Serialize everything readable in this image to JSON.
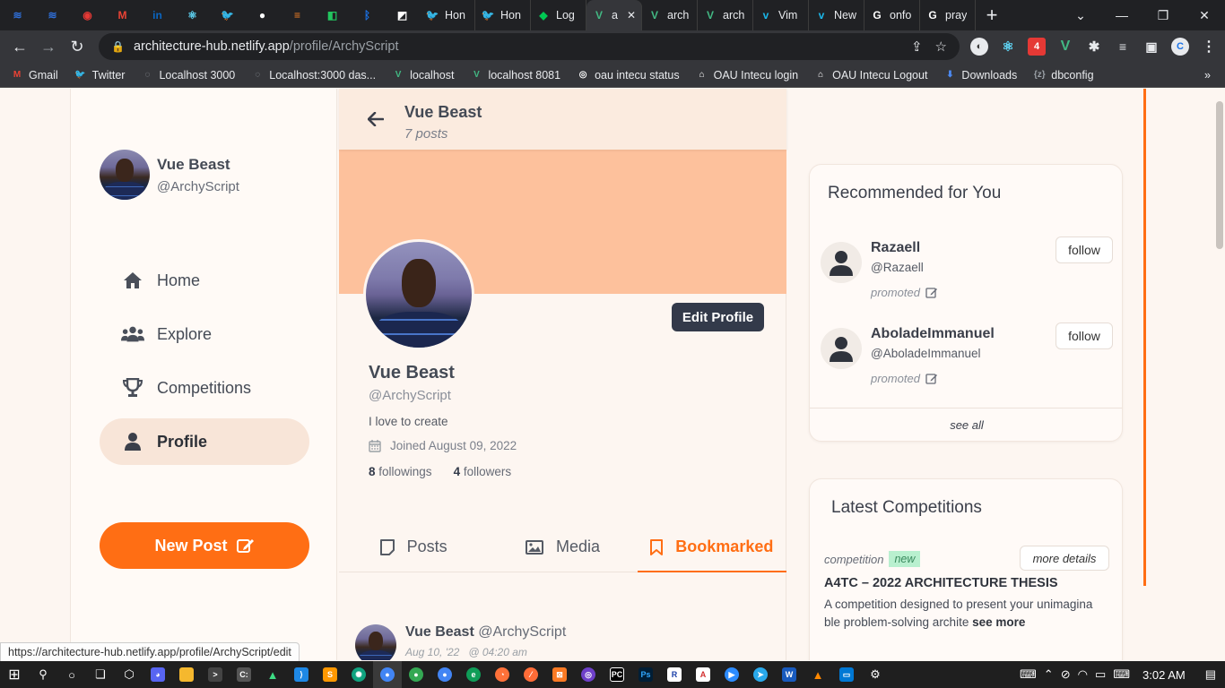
{
  "browser": {
    "tabs": [
      {
        "title": "",
        "color": "#2f6fd8",
        "glyph": "≋"
      },
      {
        "title": "",
        "color": "#2f6fd8",
        "glyph": "≋"
      },
      {
        "title": "",
        "color": "#e53935",
        "glyph": "◉"
      },
      {
        "title": "",
        "color": "#ea4335",
        "glyph": "M"
      },
      {
        "title": "",
        "color": "#0a66c2",
        "glyph": "in"
      },
      {
        "title": "",
        "color": "#61dafb",
        "glyph": "⚛"
      },
      {
        "title": "",
        "color": "#1d9bf0",
        "glyph": "🐦"
      },
      {
        "title": "",
        "color": "#ffffff",
        "glyph": "●"
      },
      {
        "title": "",
        "color": "#f48024",
        "glyph": "≡"
      },
      {
        "title": "",
        "color": "#22c55e",
        "glyph": "◧"
      },
      {
        "title": "",
        "color": "#1a73e8",
        "glyph": "ᛒ"
      },
      {
        "title": "",
        "color": "#ffffff",
        "glyph": "◩"
      },
      {
        "title": "Hon",
        "color": "#1d9bf0",
        "glyph": "🐦"
      },
      {
        "title": "Hon",
        "color": "#1d9bf0",
        "glyph": "🐦"
      },
      {
        "title": "Log",
        "color": "#00c853",
        "glyph": "◆"
      },
      {
        "title": "a",
        "color": "#42b883",
        "glyph": "V",
        "active": true
      },
      {
        "title": "arch",
        "color": "#42b883",
        "glyph": "V"
      },
      {
        "title": "arch",
        "color": "#42b883",
        "glyph": "V"
      },
      {
        "title": "Vim",
        "color": "#1ab7ea",
        "glyph": "v"
      },
      {
        "title": "New",
        "color": "#1ab7ea",
        "glyph": "v"
      },
      {
        "title": "onfo",
        "color": "#ffffff",
        "glyph": "G"
      },
      {
        "title": "pray",
        "color": "#ffffff",
        "glyph": "G"
      }
    ],
    "new_tab": "+",
    "url_host": "architecture-hub.netlify.app",
    "url_path": "/profile/ArchyScript",
    "bookmarks": [
      {
        "label": "Gmail",
        "icon": "M",
        "color": "#ea4335"
      },
      {
        "label": "Twitter",
        "icon": "🐦",
        "color": "#1d9bf0"
      },
      {
        "label": "Localhost 3000",
        "icon": "◌",
        "color": "#9aa0a6"
      },
      {
        "label": "Localhost:3000 das...",
        "icon": "◌",
        "color": "#9aa0a6"
      },
      {
        "label": "localhost",
        "icon": "V",
        "color": "#42b883"
      },
      {
        "label": "localhost 8081",
        "icon": "V",
        "color": "#42b883"
      },
      {
        "label": "oau intecu status",
        "icon": "◎",
        "color": "#ffffff"
      },
      {
        "label": "OAU Intecu login",
        "icon": "⌂",
        "color": "#ffffff"
      },
      {
        "label": "OAU Intecu Logout",
        "icon": "⌂",
        "color": "#ffffff"
      },
      {
        "label": "Downloads",
        "icon": "⬇",
        "color": "#4c8bf5"
      },
      {
        "label": "dbconfig",
        "icon": "{z}",
        "color": "#9aa0a6"
      }
    ],
    "status_url": "https://architecture-hub.netlify.app/profile/ArchyScript/edit"
  },
  "sidebar": {
    "user_name": "Vue Beast",
    "user_handle": "@ArchyScript",
    "nav": [
      {
        "label": "Home",
        "icon": "home-icon"
      },
      {
        "label": "Explore",
        "icon": "users-icon"
      },
      {
        "label": "Competitions",
        "icon": "trophy-icon"
      },
      {
        "label": "Profile",
        "icon": "user-icon",
        "active": true
      }
    ],
    "new_post_label": "New Post"
  },
  "profile": {
    "header_name": "Vue Beast",
    "header_posts": "7 posts",
    "edit_label": "Edit Profile",
    "name": "Vue Beast",
    "handle": "@ArchyScript",
    "bio": "I love to create",
    "joined": "Joined August 09, 2022",
    "followings_count": "8",
    "followings_label": "followings",
    "followers_count": "4",
    "followers_label": "followers",
    "tabs": [
      {
        "label": "Posts",
        "icon": "post-icon"
      },
      {
        "label": "Media",
        "icon": "image-icon"
      },
      {
        "label": "Bookmarked",
        "icon": "bookmark-icon",
        "active": true
      }
    ],
    "post": {
      "name": "Vue Beast",
      "handle": "@ArchyScript",
      "date": "Aug 10, '22",
      "time": "@ 04:20 am"
    }
  },
  "recommended": {
    "title": "Recommended for You",
    "users": [
      {
        "name": "Razaell",
        "handle": "@Razaell",
        "promo": "promoted",
        "follow": "follow"
      },
      {
        "name": "AboladeImmanuel",
        "handle": "@AboladeImmanuel",
        "promo": "promoted",
        "follow": "follow"
      }
    ],
    "see_all": "see all"
  },
  "competitions": {
    "title": "Latest Competitions",
    "item": {
      "kind": "competition",
      "badge": "new",
      "more": "more details",
      "name": "A4TC – 2022 ARCHITECTURE THESIS",
      "desc": "A competition designed to present your unimagina ble problem-solving archite",
      "see_more": "see more"
    }
  },
  "taskbar": {
    "time": "3:02 AM"
  },
  "colors": {
    "accent": "#ff6e14",
    "cover": "#fdc19c",
    "dark_button": "#333a4a",
    "active_nav": "#f8e5d8",
    "badge_bg": "#b9f0cf"
  }
}
